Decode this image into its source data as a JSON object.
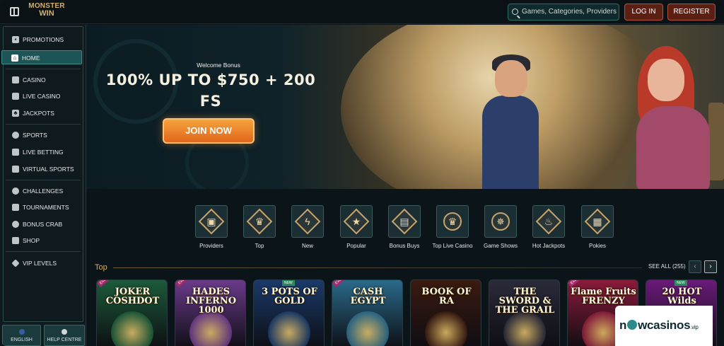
{
  "header": {
    "logo_line1": "MONSTER",
    "logo_line2": "WIN",
    "search_placeholder": "Games, Categories, Providers",
    "login_label": "LOG IN",
    "register_label": "REGISTER"
  },
  "sidebar": {
    "items": [
      {
        "label": "PROMOTIONS",
        "icon": "gift-icon"
      },
      {
        "label": "HOME",
        "icon": "home-icon",
        "active": true
      },
      {
        "label": "CASINO",
        "icon": "slot-icon"
      },
      {
        "label": "LIVE CASINO",
        "icon": "cards-icon"
      },
      {
        "label": "JACKPOTS",
        "icon": "clover-icon"
      },
      {
        "label": "SPORTS",
        "icon": "ball-icon"
      },
      {
        "label": "LIVE BETTING",
        "icon": "screen-icon"
      },
      {
        "label": "VIRTUAL SPORTS",
        "icon": "monitor-icon"
      },
      {
        "label": "CHALLENGES",
        "icon": "target-icon"
      },
      {
        "label": "TOURNAMENTS",
        "icon": "trophy-icon"
      },
      {
        "label": "BONUS CRAB",
        "icon": "crab-icon"
      },
      {
        "label": "SHOP",
        "icon": "bag-icon"
      },
      {
        "label": "VIP LEVELS",
        "icon": "diamond-icon"
      }
    ],
    "language_label": "ENGLISH",
    "help_label": "HELP CENTRE"
  },
  "hero": {
    "welcome": "Welcome Bonus",
    "bonus_line1": "100% UP TO $750 + 200",
    "bonus_line2": "FS",
    "cta": "JOIN NOW"
  },
  "categories": [
    {
      "label": "Providers",
      "icon": "box-icon"
    },
    {
      "label": "Top",
      "icon": "crown-icon"
    },
    {
      "label": "New",
      "icon": "lightning-icon"
    },
    {
      "label": "Popular",
      "icon": "star-icon"
    },
    {
      "label": "Bonus Buys",
      "icon": "chest-icon"
    },
    {
      "label": "Top Live Casino",
      "icon": "chip-icon"
    },
    {
      "label": "Game Shows",
      "icon": "wheel-icon"
    },
    {
      "label": "Hot Jackpots",
      "icon": "flame-icon"
    },
    {
      "label": "Pokies",
      "icon": "slot-machine-icon"
    }
  ],
  "top_section": {
    "title": "Top",
    "see_all": "SEE ALL (255)"
  },
  "games": [
    {
      "title": "JOKER COSHDOT",
      "badge": "EXCLUSIVE",
      "color": "#1c5a3a"
    },
    {
      "title": "HADES INFERNO 1000",
      "badge": "EXCLUSIVE",
      "color": "#6a3a8a"
    },
    {
      "title": "3 POTS OF GOLD",
      "badge": "NEW",
      "color": "#1a3a6a"
    },
    {
      "title": "CASH EGYPT",
      "badge": "EXCLUSIVE",
      "color": "#2a6a8a"
    },
    {
      "title": "BOOK OF RA",
      "badge": "",
      "color": "#3a1a10"
    },
    {
      "title": "THE SWORD & THE GRAIL",
      "badge": "",
      "color": "#2a2a3a"
    },
    {
      "title": "Flame Fruits FRENZY",
      "badge": "EXCLUSIVE",
      "color": "#8a1a3a"
    },
    {
      "title": "20 HOT Wilds",
      "badge": "NEW",
      "color": "#6a1a7a"
    }
  ],
  "watermark": {
    "text_a": "n",
    "text_b": "wcasinos",
    "suffix": ".vip"
  }
}
